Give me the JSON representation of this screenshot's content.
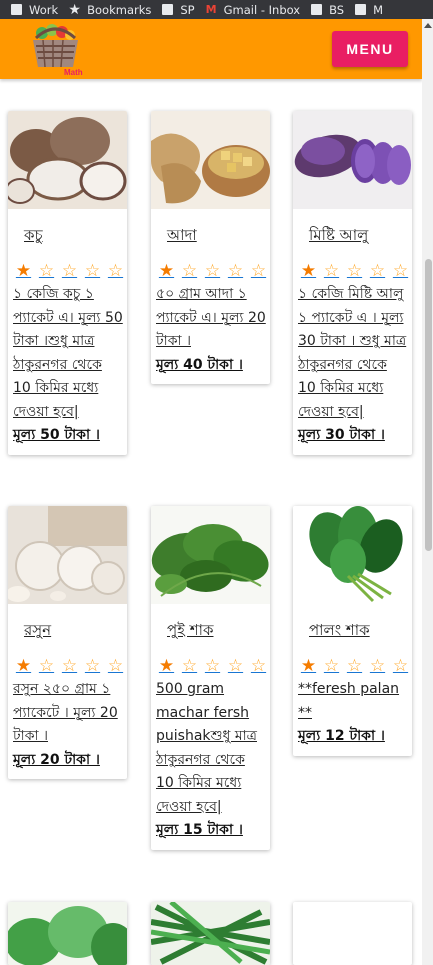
{
  "bookmarks_bar": {
    "items": [
      {
        "label": "Work",
        "icon": "folder-icon"
      },
      {
        "label": "Bookmarks",
        "icon": "star-icon"
      },
      {
        "label": "SP",
        "icon": "folder-icon"
      },
      {
        "label": "Gmail - Inbox",
        "icon": "gmail-icon"
      },
      {
        "label": "BS",
        "icon": "folder-icon"
      },
      {
        "label": "M",
        "icon": "folder-icon"
      }
    ]
  },
  "header": {
    "logo_text": "Math",
    "menu_label": "MENU",
    "background_color": "#ff9800",
    "menu_color": "#e91e63"
  },
  "products": [
    {
      "name": "কচু",
      "rating": 1,
      "max_rating": 5,
      "description": "১ কেজি কচু ১ প্যাকেট এ। মূল্য 50 টাকা ।শুধু মাত্র ঠাকুরনগর থেকে 10 কিমির মধ্যে দেওয়া হবে|",
      "price": "মূল্য 50 টাকা ।"
    },
    {
      "name": "আদা",
      "rating": 1,
      "max_rating": 5,
      "description": "৫০ গ্রাম আদা ১ প্যাকেট এ। মূল্য 20 টাকা ।",
      "price": "মূল্য 40 টাকা ।"
    },
    {
      "name": "মিষ্টি আলু",
      "rating": 1,
      "max_rating": 5,
      "description": "১ কেজি মিষ্টি আলু ১ প্যাকেট এ । মূল্য 30 টাকা । শুধু মাত্র ঠাকুরনগর থেকে 10 কিমির মধ্যে দেওয়া হবে|",
      "price": "মূল্য 30 টাকা ।"
    },
    {
      "name": "রসুন",
      "rating": 1,
      "max_rating": 5,
      "description": "রসুন ২৫০ গ্রাম ১ প্যাকেটে । মূল্য 20 টাকা ।",
      "price": "মূল্য 20 টাকা ।"
    },
    {
      "name": "পুই শাক",
      "rating": 1,
      "max_rating": 5,
      "description": "500 gram machar fersh puishakশুধু মাত্র ঠাকুরনগর থেকে 10 কিমির মধ্যে দেওয়া হবে|",
      "price": "মূল্য 15 টাকা ।"
    },
    {
      "name": "পালং শাক",
      "rating": 1,
      "max_rating": 5,
      "description": "**feresh palan **",
      "price": "মূল্য 12 টাকা ।"
    }
  ]
}
